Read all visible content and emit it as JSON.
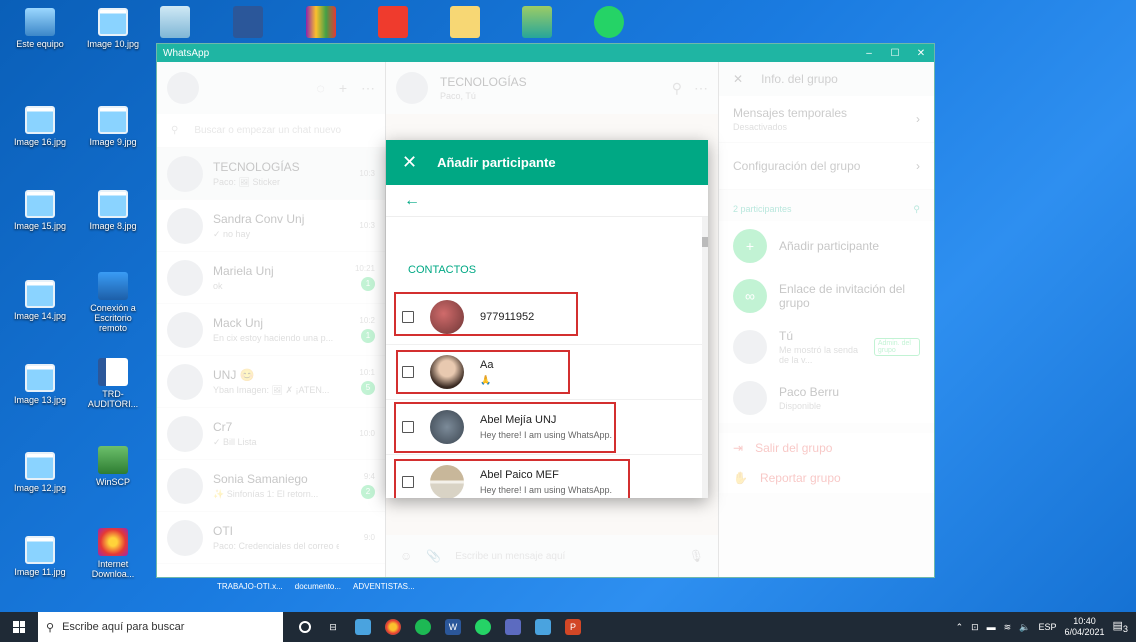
{
  "desktop": {
    "icons": [
      {
        "label": "Este equipo",
        "icon": "computer-icon"
      },
      {
        "label": "Image 10.jpg",
        "icon": "image-file-icon"
      },
      {
        "label": "Image 16.jpg",
        "icon": "image-file-icon"
      },
      {
        "label": "Image 9.jpg",
        "icon": "image-file-icon"
      },
      {
        "label": "Image 15.jpg",
        "icon": "image-file-icon"
      },
      {
        "label": "Image 8.jpg",
        "icon": "image-file-icon"
      },
      {
        "label": "Image 14.jpg",
        "icon": "image-file-icon"
      },
      {
        "label": "Conexión a Escritorio remoto",
        "icon": "remote-desktop-icon"
      },
      {
        "label": "Image 13.jpg",
        "icon": "image-file-icon"
      },
      {
        "label": "TRD-AUDITORI...",
        "icon": "word-document-icon"
      },
      {
        "label": "Image 12.jpg",
        "icon": "image-file-icon"
      },
      {
        "label": "WinSCP",
        "icon": "winscp-icon"
      },
      {
        "label": "Image 11.jpg",
        "icon": "image-file-icon"
      },
      {
        "label": "Internet Downloa...",
        "icon": "internet-download-manager-icon"
      }
    ],
    "bottom_strip": [
      "TRABAJO-OTI.x...",
      "documento...",
      "ADVENTISTAS..."
    ]
  },
  "window": {
    "title": "WhatsApp",
    "controls": [
      "–",
      "☐",
      "✕"
    ]
  },
  "left": {
    "search_placeholder": "Buscar o empezar un chat nuevo",
    "chats": [
      {
        "name": "TECNOLOGÍAS",
        "preview": "Paco: 🖼 Sticker",
        "time": "10:3",
        "badge": ""
      },
      {
        "name": "Sandra Conv Unj",
        "preview": "✓ no hay",
        "time": "10:3",
        "badge": ""
      },
      {
        "name": "Mariela Unj",
        "preview": "ok",
        "time": "10:21",
        "badge": "1"
      },
      {
        "name": "Mack Unj",
        "preview": "En cix estoy haciendo una p...",
        "time": "10:2",
        "badge": "1"
      },
      {
        "name": "UNJ 😊",
        "preview": "Yban Imagen: 🖼 ✗ ¡ATEN...",
        "time": "10:1",
        "badge": "5"
      },
      {
        "name": "Cr7",
        "preview": "✓ Bill Lista",
        "time": "10:0",
        "badge": ""
      },
      {
        "name": "Sonia Samaniego",
        "preview": "✨ Sinfonías 1: El retorn...",
        "time": "9:4",
        "badge": "2"
      },
      {
        "name": "OTI",
        "preview": "Paco: Credenciales del correo ele...",
        "time": "9:0",
        "badge": ""
      }
    ]
  },
  "middle": {
    "title": "TECNOLOGÍAS",
    "subtitle": "Paco, Tú",
    "compose_placeholder": "Escribe un mensaje aquí"
  },
  "right": {
    "header": "Info. del grupo",
    "items": [
      {
        "label": "Mensajes temporales",
        "sub": "Desactivados"
      },
      {
        "label": "Configuración del grupo",
        "sub": ""
      }
    ],
    "participants_label": "2 participantes",
    "add_participant": "Añadir participante",
    "invite_link": "Enlace de invitación del grupo",
    "members": [
      {
        "name": "Tú",
        "status": "Me mostró la senda de la v...",
        "tag": "Admin. del grupo"
      },
      {
        "name": "Paco Berru",
        "status": "Disponible",
        "tag": ""
      }
    ],
    "exit": "Salir del grupo",
    "report": "Reportar grupo"
  },
  "modal": {
    "title": "Añadir participante",
    "section": "CONTACTOS",
    "contacts": [
      {
        "name": "977911952",
        "status": ""
      },
      {
        "name": "Aa",
        "status": "🙏"
      },
      {
        "name": "Abel Mejía UNJ",
        "status": "Hey there! I am using WhatsApp."
      },
      {
        "name": "Abel Paico MEF",
        "status": "Hey there! I am using WhatsApp."
      }
    ]
  },
  "taskbar": {
    "search_placeholder": "Escribe aquí para buscar",
    "lang": "ESP",
    "time": "10:40",
    "date": "6/04/2021",
    "notifications": "3"
  },
  "colors": {
    "accent": "#00a884",
    "title_bar": "#1fb5a3",
    "highlight_box": "#d32f2f"
  }
}
